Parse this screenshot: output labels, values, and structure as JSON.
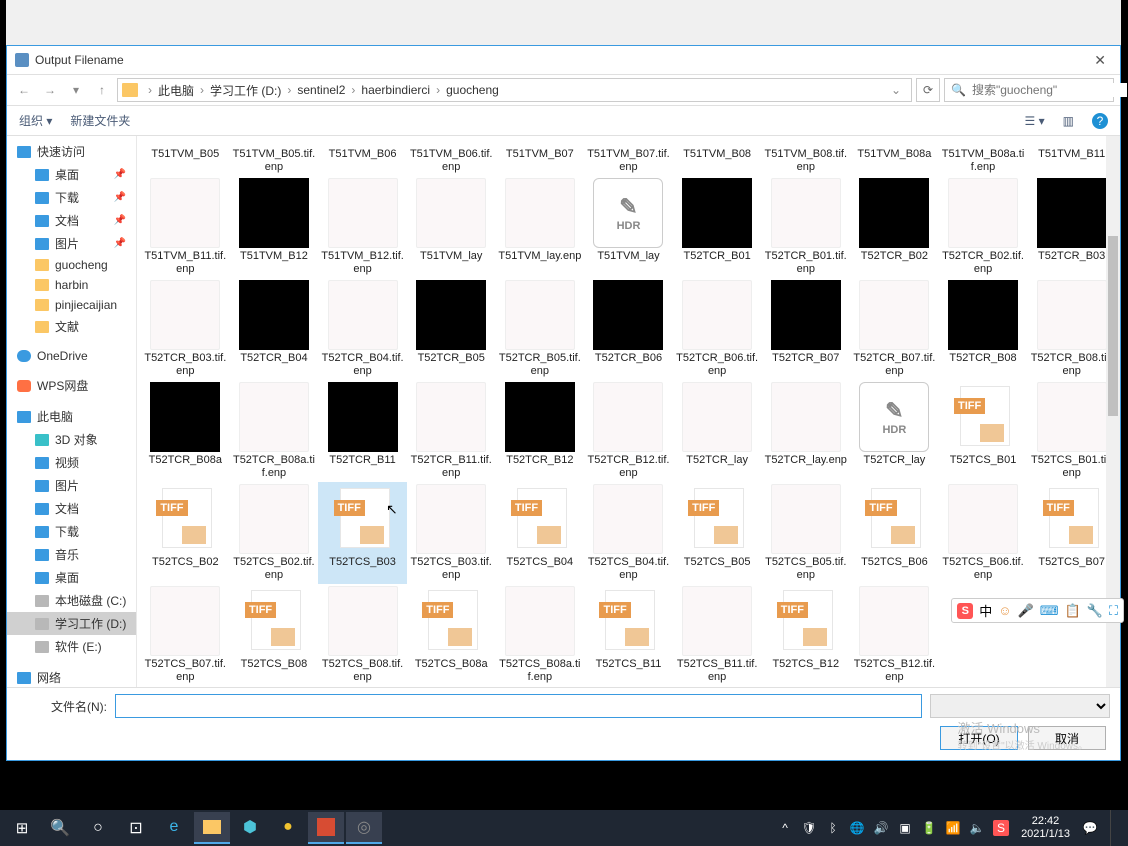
{
  "window": {
    "title": "Output Filename"
  },
  "breadcrumb": {
    "root": "此电脑",
    "parts": [
      "学习工作 (D:)",
      "sentinel2",
      "haerbindierci",
      "guocheng"
    ]
  },
  "search": {
    "placeholder": "搜索\"guocheng\""
  },
  "toolbar": {
    "organize": "组织 ▾",
    "newfolder": "新建文件夹"
  },
  "sidebar": {
    "quick": "快速访问",
    "desktop": "桌面",
    "downloads": "下载",
    "documents": "文档",
    "pictures": "图片",
    "guocheng": "guocheng",
    "harbin": "harbin",
    "pinjie": "pinjiecaijian",
    "wenxian": "文献",
    "onedrive": "OneDrive",
    "wps": "WPS网盘",
    "thispc": "此电脑",
    "td": "3D 对象",
    "video": "视频",
    "pics2": "图片",
    "docs2": "文档",
    "dl2": "下载",
    "music": "音乐",
    "desk2": "桌面",
    "drivec": "本地磁盘 (C:)",
    "drived": "学习工作 (D:)",
    "drivee": "软件 (E:)",
    "network": "网络"
  },
  "files": [
    [
      "T51TVM_B05",
      "trim"
    ],
    [
      "T51TVM_B05.tif.enp",
      "trim"
    ],
    [
      "T51TVM_B06",
      "trim"
    ],
    [
      "T51TVM_B06.tif.enp",
      "trim"
    ],
    [
      "T51TVM_B07",
      "trim"
    ],
    [
      "T51TVM_B07.tif.enp",
      "trim"
    ],
    [
      "T51TVM_B08",
      "trim"
    ],
    [
      "T51TVM_B08.tif.enp",
      "trim"
    ],
    [
      "T51TVM_B08a",
      "trim"
    ],
    [
      "T51TVM_B08a.tif.enp",
      "trim"
    ],
    [
      "T51TVM_B11",
      "trim"
    ],
    [
      "T51TVM_B11.tif.enp",
      "blank"
    ],
    [
      "T51TVM_B12",
      "black"
    ],
    [
      "T51TVM_B12.tif.enp",
      "blank"
    ],
    [
      "T51TVM_lay",
      "blank"
    ],
    [
      "T51TVM_lay.enp",
      "blank"
    ],
    [
      "T51TVM_lay",
      "hdr"
    ],
    [
      "T52TCR_B01",
      "black"
    ],
    [
      "T52TCR_B01.tif.enp",
      "blank"
    ],
    [
      "T52TCR_B02",
      "black"
    ],
    [
      "T52TCR_B02.tif.enp",
      "blank"
    ],
    [
      "T52TCR_B03",
      "black"
    ],
    [
      "T52TCR_B03.tif.enp",
      "blank"
    ],
    [
      "T52TCR_B04",
      "black"
    ],
    [
      "T52TCR_B04.tif.enp",
      "blank"
    ],
    [
      "T52TCR_B05",
      "black"
    ],
    [
      "T52TCR_B05.tif.enp",
      "blank"
    ],
    [
      "T52TCR_B06",
      "black"
    ],
    [
      "T52TCR_B06.tif.enp",
      "blank"
    ],
    [
      "T52TCR_B07",
      "black"
    ],
    [
      "T52TCR_B07.tif.enp",
      "blank"
    ],
    [
      "T52TCR_B08",
      "black"
    ],
    [
      "T52TCR_B08.tif.enp",
      "blank"
    ],
    [
      "T52TCR_B08a",
      "black"
    ],
    [
      "T52TCR_B08a.tif.enp",
      "blank"
    ],
    [
      "T52TCR_B11",
      "black"
    ],
    [
      "T52TCR_B11.tif.enp",
      "blank"
    ],
    [
      "T52TCR_B12",
      "black"
    ],
    [
      "T52TCR_B12.tif.enp",
      "blank"
    ],
    [
      "T52TCR_lay",
      "blank"
    ],
    [
      "T52TCR_lay.enp",
      "blank"
    ],
    [
      "T52TCR_lay",
      "hdr"
    ],
    [
      "T52TCS_B01",
      "tiff"
    ],
    [
      "T52TCS_B01.tif.enp",
      "blank"
    ],
    [
      "T52TCS_B02",
      "tiff"
    ],
    [
      "T52TCS_B02.tif.enp",
      "blank"
    ],
    [
      "T52TCS_B03",
      "tiff",
      "selected"
    ],
    [
      "T52TCS_B03.tif.enp",
      "blank"
    ],
    [
      "T52TCS_B04",
      "tiff"
    ],
    [
      "T52TCS_B04.tif.enp",
      "blank"
    ],
    [
      "T52TCS_B05",
      "tiff"
    ],
    [
      "T52TCS_B05.tif.enp",
      "blank"
    ],
    [
      "T52TCS_B06",
      "tiff"
    ],
    [
      "T52TCS_B06.tif.enp",
      "blank"
    ],
    [
      "T52TCS_B07",
      "tiff"
    ],
    [
      "T52TCS_B07.tif.enp",
      "blank"
    ],
    [
      "T52TCS_B08",
      "tiff"
    ],
    [
      "T52TCS_B08.tif.enp",
      "blank"
    ],
    [
      "T52TCS_B08a",
      "tiff"
    ],
    [
      "T52TCS_B08a.tif.enp",
      "blank"
    ],
    [
      "T52TCS_B11",
      "tiff"
    ],
    [
      "T52TCS_B11.tif.enp",
      "blank"
    ],
    [
      "T52TCS_B12",
      "tiff"
    ],
    [
      "T52TCS_B12.tif.enp",
      "blank"
    ],
    [
      "",
      ""
    ],
    [
      "",
      ""
    ]
  ],
  "footer": {
    "filename_label": "文件名(N):",
    "filename_value": "",
    "open": "打开(O)",
    "cancel": "取消"
  },
  "watermark": {
    "line1": "激活 Windows",
    "line2": "转到\"设置\"以激活 Windows。"
  },
  "ime": {
    "zhong": "中",
    "icons": "☺ 🎤 ⌨ 📋 🔧 ⛶"
  },
  "taskbar": {
    "time": "22:42",
    "date": "2021/1/13"
  }
}
